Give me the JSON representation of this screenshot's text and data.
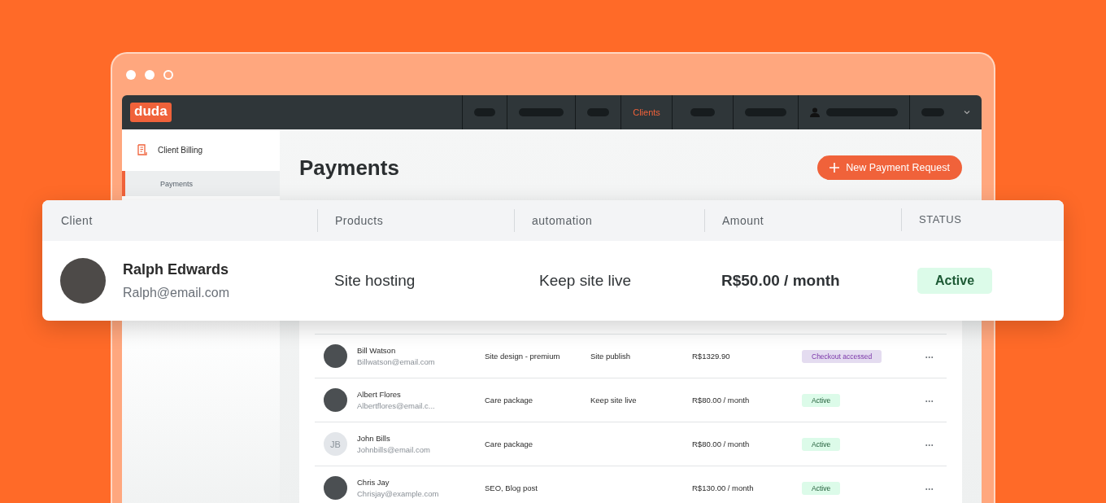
{
  "app": {
    "logo": "duda"
  },
  "nav": [
    {
      "kind": "pill",
      "selected": false
    },
    {
      "kind": "pill",
      "selected": false
    },
    {
      "kind": "pill",
      "selected": false
    },
    {
      "kind": "text",
      "label": "Clients",
      "selected": true
    },
    {
      "kind": "pill",
      "selected": false
    },
    {
      "kind": "pill",
      "selected": false
    },
    {
      "kind": "user",
      "selected": false
    },
    {
      "kind": "menu",
      "selected": false
    }
  ],
  "sidebar": {
    "section": "Client Billing",
    "items": [
      {
        "label": "Payments",
        "selected": true
      }
    ]
  },
  "page": {
    "title": "Payments",
    "new_button": "New Payment Request"
  },
  "featured": {
    "columns": [
      "Client",
      "Products",
      "automation",
      "Amount",
      "STATUS"
    ],
    "row": {
      "name": "Ralph Edwards",
      "email": "Ralph@email.com",
      "product": "Site hosting",
      "automation": "Keep site live",
      "amount": "R$50.00 / month",
      "status": {
        "label": "Active",
        "kind": "active"
      }
    }
  },
  "table": {
    "rows": [
      {
        "name": "Bill Watson",
        "email": "Billwatson@email.com",
        "product": "Site design - premium",
        "automation": "Site publish",
        "amount": "R$1329.90",
        "status": {
          "label": "Checkout accessed",
          "kind": "checkout"
        },
        "menu": "•••"
      },
      {
        "name": "Albert Flores",
        "email": "Albertflores@email.c...",
        "product": "Care package",
        "automation": "Keep site live",
        "amount": "R$80.00 / month",
        "status": {
          "label": "Active",
          "kind": "active"
        },
        "menu": "•••"
      },
      {
        "name": "John Bills",
        "email": "Johnbills@email.com",
        "initials": "JB",
        "product": "Care package",
        "amount": "R$80.00 / month",
        "status": {
          "label": "Active",
          "kind": "active"
        },
        "menu": "•••"
      },
      {
        "name": "Chris Jay",
        "email": "Chrisjay@example.com",
        "product": "SEO, Blog post",
        "amount": "R$130.00 / month",
        "status": {
          "label": "Active",
          "kind": "active"
        },
        "menu": "•••"
      }
    ]
  }
}
